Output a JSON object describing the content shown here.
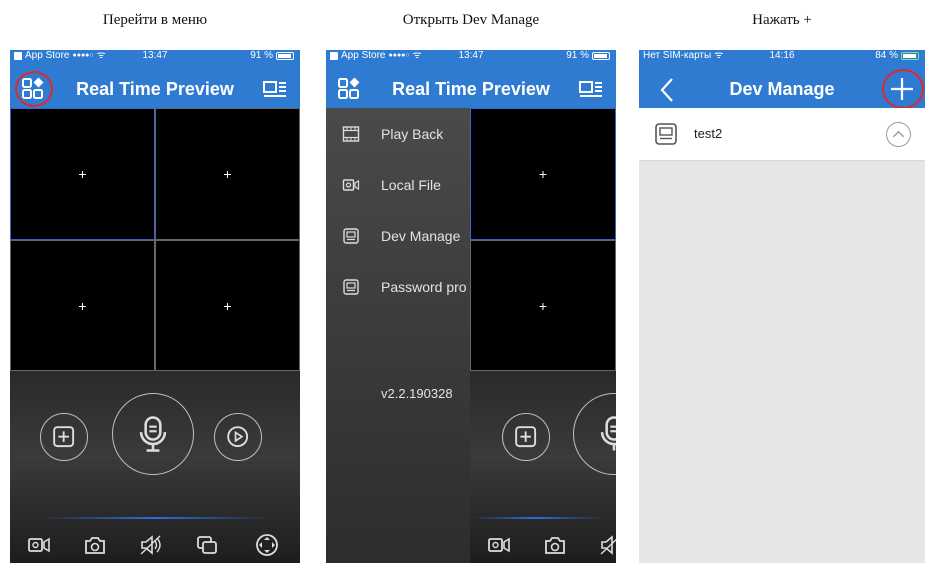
{
  "captions": [
    "Перейти в меню",
    "Открыть Dev Manage",
    "Нажать +"
  ],
  "screen1": {
    "status": {
      "carrier": "App Store",
      "signal": "●●●●○",
      "time": "13:47",
      "battery": "91 %"
    },
    "title": "Real Time Preview",
    "cells": [
      "+",
      "+",
      "+",
      "+"
    ]
  },
  "screen2": {
    "status": {
      "carrier": "App Store",
      "signal": "●●●●○",
      "time": "13:47",
      "battery": "91 %"
    },
    "title": "Real Time Preview",
    "menu": [
      {
        "label": "Play Back",
        "icon": "film-icon"
      },
      {
        "label": "Local File",
        "icon": "video-camera-icon"
      },
      {
        "label": "Dev Manage",
        "icon": "device-icon"
      },
      {
        "label": "Password protection",
        "icon": "device-icon"
      }
    ],
    "version": "v2.2.190328",
    "cells": [
      "+",
      "+"
    ]
  },
  "screen3": {
    "status": {
      "carrier": "Нет SIM-карты",
      "time": "14:16",
      "battery": "84 %"
    },
    "title": "Dev Manage",
    "devices": [
      {
        "name": "test2"
      }
    ]
  },
  "colors": {
    "nav_blue": "#2f7bd2",
    "highlight_red": "#e3262b",
    "grid_select": "#3a64c8"
  }
}
